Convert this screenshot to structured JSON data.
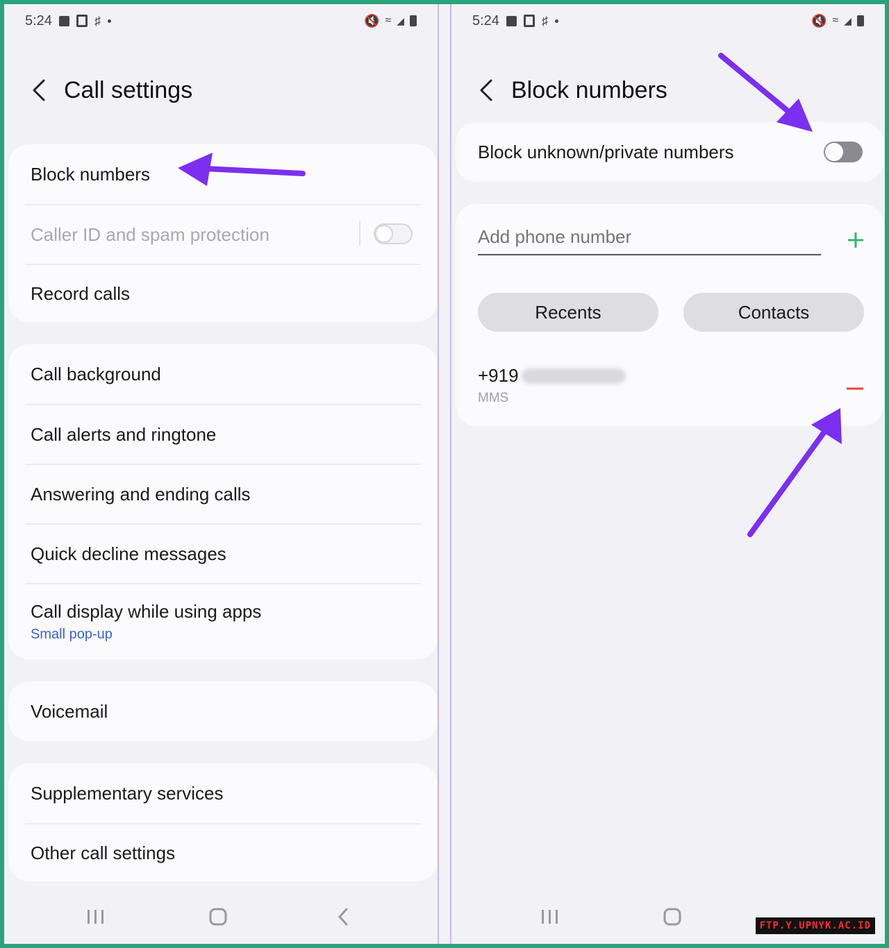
{
  "colors": {
    "accent_purple": "#7b2ff0",
    "border_green": "#2aa37c",
    "link_blue": "#3a62d6",
    "minus_red": "#e8443a",
    "plus_green": "#37b86b"
  },
  "left": {
    "status": {
      "time": "5:24"
    },
    "header": {
      "title": "Call settings"
    },
    "group1": [
      {
        "label": "Block numbers"
      },
      {
        "label": "Caller ID and spam protection",
        "disabled": true,
        "toggle_on": false
      },
      {
        "label": "Record calls"
      }
    ],
    "group2": [
      {
        "label": "Call background"
      },
      {
        "label": "Call alerts and ringtone"
      },
      {
        "label": "Answering and ending calls"
      },
      {
        "label": "Quick decline messages"
      },
      {
        "label": "Call display while using apps",
        "sub": "Small pop-up"
      }
    ],
    "group3": [
      {
        "label": "Voicemail"
      }
    ],
    "group4": [
      {
        "label": "Supplementary services"
      },
      {
        "label": "Other call settings"
      }
    ]
  },
  "right": {
    "status": {
      "time": "5:24"
    },
    "header": {
      "title": "Block numbers"
    },
    "block_unknown": {
      "label": "Block unknown/private numbers",
      "toggle_on": false
    },
    "add_number": {
      "placeholder": "Add phone number"
    },
    "buttons": {
      "recents": "Recents",
      "contacts": "Contacts"
    },
    "blocked_list": [
      {
        "number": "+919",
        "type": "MMS"
      }
    ]
  },
  "watermark": "FTP.Y.UPNYK.AC.ID"
}
